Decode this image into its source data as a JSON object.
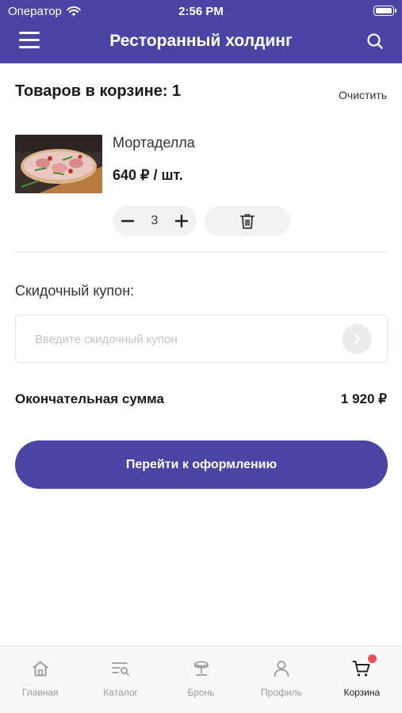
{
  "status_bar": {
    "carrier": "Оператор",
    "time": "2:56 PM",
    "battery_level": 1.0
  },
  "header": {
    "title": "Ресторанный холдинг",
    "menu_icon": "hamburger-menu-icon",
    "search_icon": "search-icon"
  },
  "cart": {
    "count_label": "Товаров в корзине: 1",
    "clear_label": "Очистить",
    "items": [
      {
        "name": "Мортаделла",
        "price": "640 ₽ / шт.",
        "quantity": "3",
        "image": "pizza-photo"
      }
    ]
  },
  "coupon": {
    "label": "Скидочный купон:",
    "value": "",
    "placeholder": "Введите скидочный купон"
  },
  "total": {
    "label": "Окончательная сумма",
    "value": "1 920 ₽"
  },
  "checkout": {
    "label": "Перейти к оформлению"
  },
  "tabbar": {
    "tabs": [
      {
        "label": "Главная",
        "icon": "home-icon",
        "active": false
      },
      {
        "label": "Каталог",
        "icon": "catalog-icon",
        "active": false
      },
      {
        "label": "Бронь",
        "icon": "cloche-icon",
        "active": false
      },
      {
        "label": "Профиль",
        "icon": "profile-icon",
        "active": false
      },
      {
        "label": "Корзина",
        "icon": "cart-icon",
        "active": true,
        "badge": true
      }
    ]
  },
  "colors": {
    "brand": "#4a45a4",
    "badge": "#e8505b",
    "inactive_tab": "#9a9a9a"
  }
}
